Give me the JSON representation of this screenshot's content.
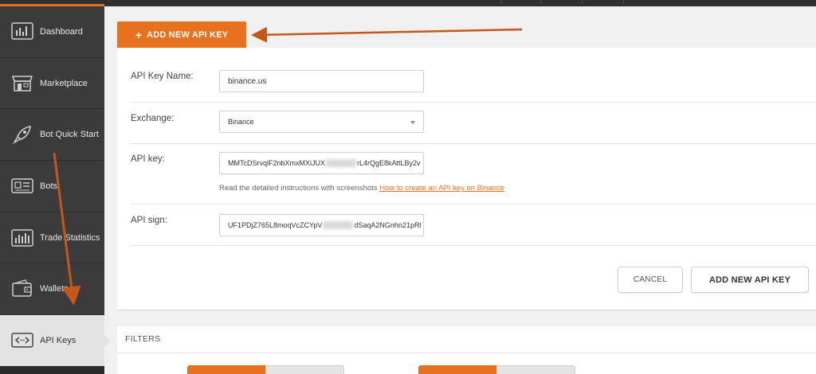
{
  "sidebar": {
    "items": [
      {
        "label": "Dashboard",
        "icon": "dashboard-icon"
      },
      {
        "label": "Marketplace",
        "icon": "store-icon"
      },
      {
        "label": "Bot Quick Start",
        "icon": "rocket-icon"
      },
      {
        "label": "Bots",
        "icon": "bots-icon"
      },
      {
        "label": "Trade Statistics",
        "icon": "bar-chart-icon"
      },
      {
        "label": "Wallets",
        "icon": "wallet-icon"
      },
      {
        "label": "API Keys",
        "icon": "code-brackets-icon",
        "active": true
      }
    ]
  },
  "tab": {
    "label": "ADD NEW API KEY",
    "plus": "+"
  },
  "form": {
    "name_label": "API Key Name:",
    "name_value": "binance.us",
    "exchange_label": "Exchange:",
    "exchange_value": "Binance",
    "apikey_label": "API key:",
    "apikey_value_start": "MMTcDSrvqlF2nbXmxMXiJUX",
    "apikey_value_end": "rL4rQgE8kAttLBy2v",
    "help_text": "Read the detailed instructions with screenshots ",
    "help_link": "How to create an API key on Binance",
    "apisign_label": "API sign:",
    "apisign_value_start": "UF1PDjZ765L8moqVcZCYpV",
    "apisign_value_end": "dSaqA2NGnhn21pRl"
  },
  "buttons": {
    "cancel": "CANCEL",
    "add": "ADD NEW API KEY"
  },
  "filters": {
    "title": "FILTERS"
  },
  "colors": {
    "accent": "#e8711f",
    "sidebar": "#3b3b3b",
    "annotation_arrow": "#c4581a"
  }
}
